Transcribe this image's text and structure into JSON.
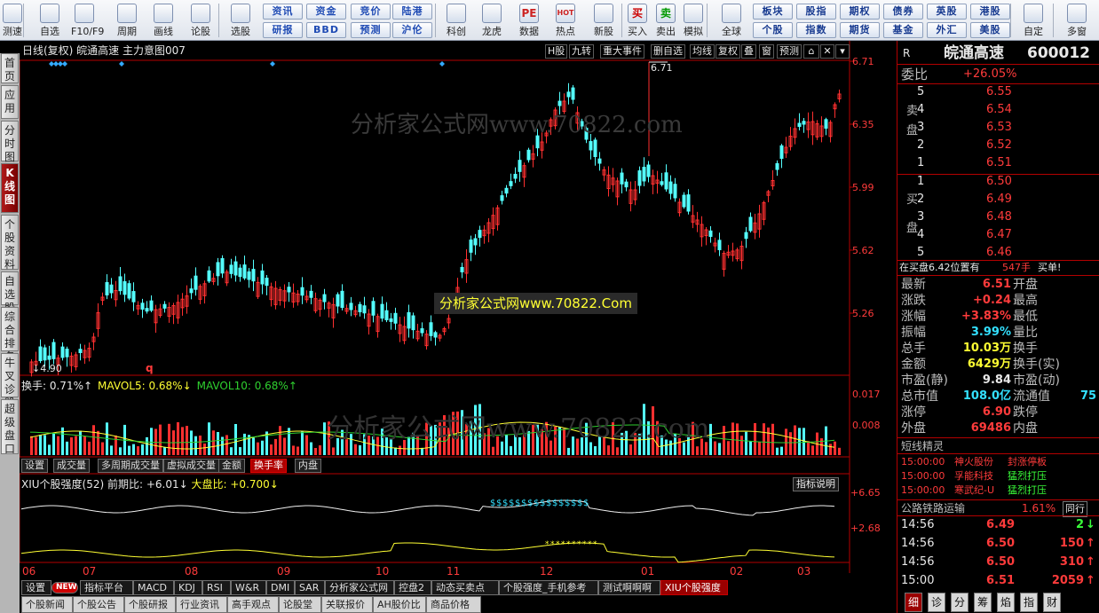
{
  "toolbar": {
    "items": [
      {
        "label": "测速",
        "icon": "speed-test-icon"
      },
      {
        "label": "自选",
        "icon": "star-icon"
      },
      {
        "label": "F10/F9",
        "icon": "f10-info-icon"
      },
      {
        "label": "周期",
        "icon": "clock-icon"
      },
      {
        "label": "画线",
        "icon": "pencil-icon"
      },
      {
        "label": "论股",
        "icon": "discuss-icon"
      },
      {
        "label": "选股",
        "icon": "stock-picker-icon"
      },
      {
        "label": "科创",
        "icon": "tech-board-icon"
      },
      {
        "label": "龙虎",
        "icon": "dragon-tiger-icon"
      },
      {
        "label": "数据",
        "icon": "data-pe-icon"
      },
      {
        "label": "热点",
        "icon": "hotspot-icon"
      },
      {
        "label": "新股",
        "icon": "new-stock-icon"
      },
      {
        "label": "买入",
        "icon": "buy-icon"
      },
      {
        "label": "卖出",
        "icon": "sell-icon"
      },
      {
        "label": "模拟",
        "icon": "simulate-icon"
      },
      {
        "label": "全球",
        "icon": "globe-icon"
      },
      {
        "label": "自定",
        "icon": "custom-icon"
      },
      {
        "label": "多窗",
        "icon": "multi-window-icon"
      }
    ],
    "quick_buttons_row1": [
      "资讯",
      "资金",
      "竞价",
      "陆港"
    ],
    "quick_buttons_row2": [
      "研报",
      "BBD",
      "预测",
      "沪伦"
    ],
    "exchange_row1": [
      "板块",
      "股指",
      "期权",
      "债券",
      "英股",
      "港股"
    ],
    "exchange_row2": [
      "个股",
      "指数",
      "期货",
      "基金",
      "外汇",
      "美股"
    ],
    "buy_glyph": "买",
    "sell_glyph": "卖",
    "data_glyph": "PE",
    "hot_glyph": "HOT"
  },
  "left_tabs": [
    "首页",
    "应用",
    "分时图",
    "K线图",
    "个股资料",
    "自选股",
    "综合排名",
    "牛叉诊股",
    "超级盘口"
  ],
  "active_left_tab": "K线图",
  "chart_header": {
    "title": "日线(复权)  皖通高速  主力意图007",
    "buttons": [
      "H股",
      "九转",
      "重大事件",
      "删自选",
      "均线",
      "复权",
      "叠",
      "窗",
      "预测"
    ]
  },
  "price_axis": {
    "labels": [
      "6.71",
      "6.35",
      "5.99",
      "5.62",
      "5.26"
    ],
    "high_mark": "6.71",
    "low_mark": "4.90",
    "marker": "q"
  },
  "watermarks": {
    "main": "分析家公式网www.70822.com",
    "banner": "分析家公式网www.70822.Com",
    "vol": "分析家公式网www.70822.com"
  },
  "vol_panel": {
    "legend": [
      {
        "text": "换手: 0.71%↑",
        "color": "#e8e8e8"
      },
      {
        "text": "MAVOL5: 0.68%↓",
        "color": "#ffff33"
      },
      {
        "text": "MAVOL10: 0.68%↑",
        "color": "#2fd02f"
      }
    ],
    "axis": [
      "0.017",
      "0.008"
    ],
    "tabs": [
      "设置",
      "成交量",
      "多周期成交量",
      "虚拟成交量",
      "金额",
      "换手率",
      "内盘"
    ],
    "active_tab": "换手率"
  },
  "xiu_panel": {
    "legend_title": "XIU个股强度(52) 前期比: +6.01↓",
    "legend_big": "大盘比: +0.700↓",
    "button": "指标说明",
    "axis": [
      "+6.65",
      "+2.68"
    ]
  },
  "date_axis": [
    "06",
    "07",
    "08",
    "09",
    "10",
    "11",
    "12",
    "01",
    "02",
    "03"
  ],
  "bottom_tabs": [
    "设置",
    "NEW",
    "指标平台",
    "MACD",
    "KDJ",
    "RSI",
    "W&R",
    "DMI",
    "SAR",
    "分析家公式网",
    "控盘2",
    "动态买卖点",
    "个股强度_手机参考",
    "测试啊啊啊",
    "XIU个股强度"
  ],
  "active_bottom_tab": "XIU个股强度",
  "bottom_tabs2": [
    "个股新闻",
    "个股公告",
    "个股研报",
    "行业资讯",
    "高手观点",
    "论股堂",
    "关联报价",
    "AH股价比",
    "商品价格"
  ],
  "quote": {
    "market": "R",
    "name": "皖通高速",
    "code": "600012",
    "weibi_label": "委比",
    "weibi": "+26.05%",
    "sell_label": "卖盘",
    "buy_label": "买盘",
    "sells": [
      {
        "n": "5",
        "p": "6.55"
      },
      {
        "n": "4",
        "p": "6.54"
      },
      {
        "n": "3",
        "p": "6.53"
      },
      {
        "n": "2",
        "p": "6.52"
      },
      {
        "n": "1",
        "p": "6.51"
      }
    ],
    "buys": [
      {
        "n": "1",
        "p": "6.50"
      },
      {
        "n": "2",
        "p": "6.49"
      },
      {
        "n": "3",
        "p": "6.48"
      },
      {
        "n": "4",
        "p": "6.47"
      },
      {
        "n": "5",
        "p": "6.46"
      }
    ],
    "notice": "在买盘6.42位置有",
    "notice_qty": "547手",
    "notice_tail": "买单!",
    "stats": [
      [
        "最新",
        "6.51",
        "开盘",
        ""
      ],
      [
        "涨跌",
        "+0.24",
        "最高",
        ""
      ],
      [
        "涨幅",
        "+3.83%",
        "最低",
        ""
      ],
      [
        "振幅",
        "3.99%",
        "量比",
        ""
      ],
      [
        "总手",
        "10.03万",
        "换手",
        ""
      ],
      [
        "金额",
        "6429万",
        "换手(实)",
        ""
      ],
      [
        "市盈(静)",
        "9.84",
        "市盈(动)",
        ""
      ],
      [
        "总市值",
        "108.0亿",
        "流通值",
        "75"
      ],
      [
        "涨停",
        "6.90",
        "跌停",
        ""
      ],
      [
        "外盘",
        "69486",
        "内盘",
        ""
      ]
    ],
    "stat_colors": [
      "#ff3b3b",
      "#ff3b3b",
      "#ff3b3b",
      "#33e0ff",
      "#ffff33",
      "#ffff33",
      "#e8e8e8",
      "#33e0ff",
      "#ff3b3b",
      "#ff3b3b"
    ],
    "sprite_title": "短线精灵",
    "sprites": [
      [
        "15:00:00",
        "神火股份",
        "封涨停板"
      ],
      [
        "15:00:00",
        "孚能科技",
        "猛烈打压"
      ],
      [
        "15:00:00",
        "寒武纪-U",
        "猛烈打压"
      ]
    ],
    "industry": "公路铁路运输",
    "industry_chg": "1.61%",
    "industry_btn": "同行",
    "ticks": [
      [
        "14:56",
        "6.49",
        "2",
        "down"
      ],
      [
        "14:56",
        "6.50",
        "150",
        "up"
      ],
      [
        "14:56",
        "6.50",
        "310",
        "up"
      ],
      [
        "15:00",
        "6.51",
        "2059",
        "up"
      ]
    ],
    "right_tabs": [
      "细",
      "诊",
      "分",
      "筹",
      "焰",
      "指",
      "财"
    ]
  }
}
